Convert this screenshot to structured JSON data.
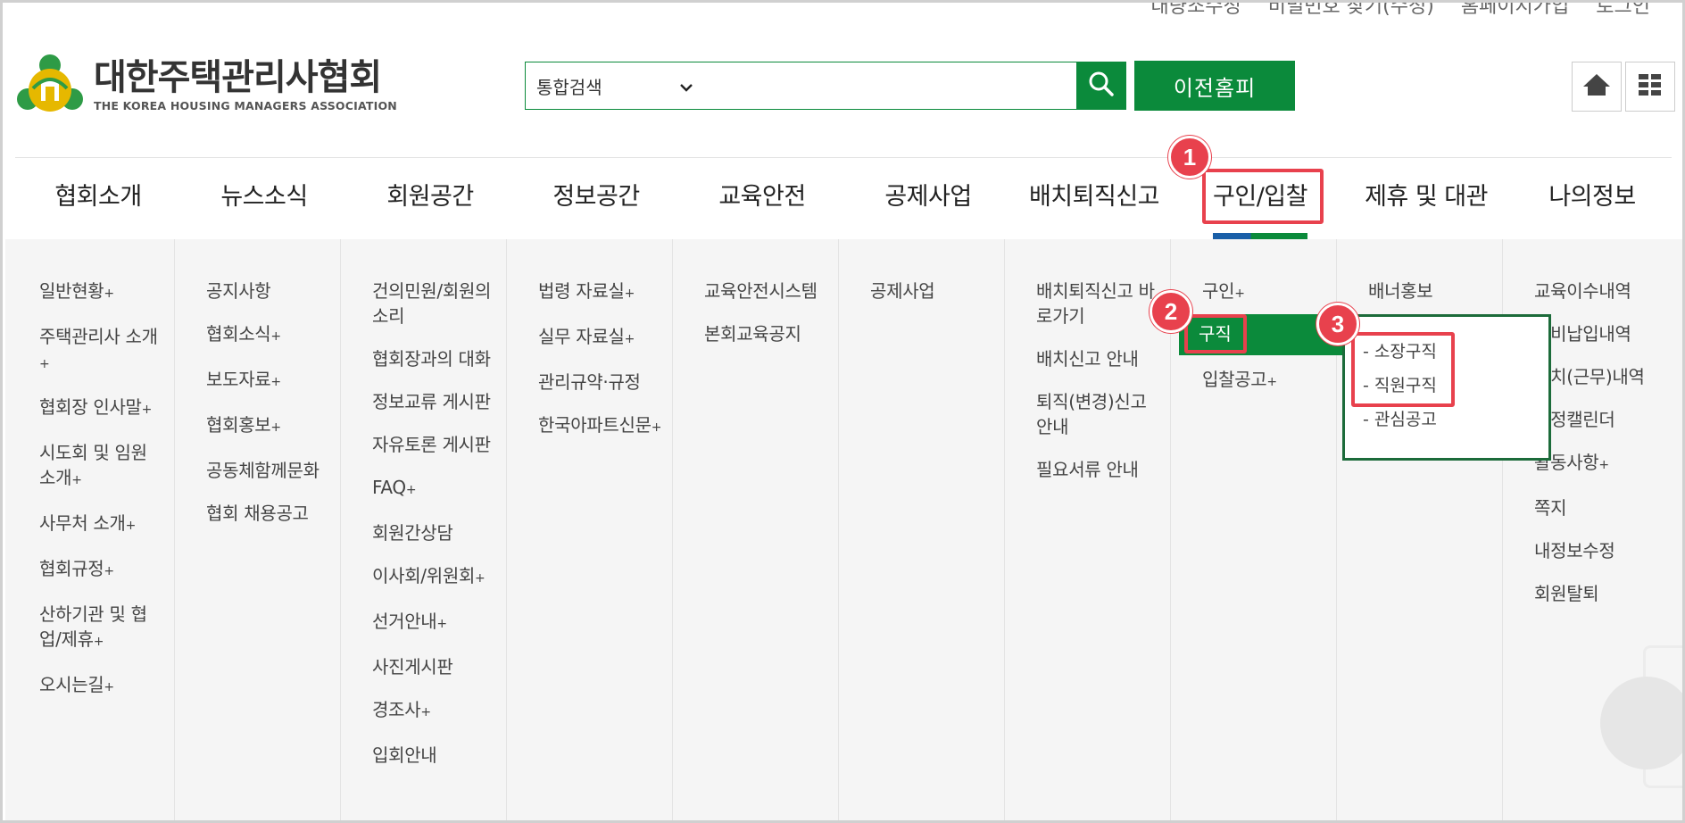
{
  "util_links": [
    "대량조수정",
    "비밀번호 찾기(수정)",
    "홈페이지가입",
    "로그인"
  ],
  "logo": {
    "name": "대한주택관리사협회",
    "sub": "THE KOREA HOUSING MANAGERS ASSOCIATION"
  },
  "search": {
    "select_label": "통합검색",
    "placeholder": ""
  },
  "prev_home_label": "이전홈피",
  "icons": {
    "search": "search-icon",
    "home": "home-icon",
    "menu": "grid-menu-icon"
  },
  "gnb": [
    "협회소개",
    "뉴스소식",
    "회원공간",
    "정보공간",
    "교육안전",
    "공제사업",
    "배치퇴직신고",
    "구인/입찰",
    "제휴 및 대관",
    "나의정보"
  ],
  "menu_columns": [
    [
      {
        "t": "일반현황",
        "p": "+"
      },
      {
        "t": "주택관리사 소개",
        "p": "+"
      },
      {
        "t": "협회장 인사말",
        "p": "+"
      },
      {
        "t": "시도회 및 임원 소개",
        "p": "+"
      },
      {
        "t": "사무처 소개",
        "p": "+"
      },
      {
        "t": "협회규정",
        "p": "+"
      },
      {
        "t": "산하기관 및 협업/제휴",
        "p": "+"
      },
      {
        "t": "오시는길",
        "p": "+"
      }
    ],
    [
      {
        "t": "공지사항",
        "p": ""
      },
      {
        "t": "협회소식",
        "p": "+"
      },
      {
        "t": "보도자료",
        "p": "+"
      },
      {
        "t": "협회홍보",
        "p": "+"
      },
      {
        "t": "공동체함께문화",
        "p": ""
      },
      {
        "t": "협회 채용공고",
        "p": ""
      }
    ],
    [
      {
        "t": "건의민원/회원의 소리",
        "p": ""
      },
      {
        "t": "협회장과의 대화",
        "p": ""
      },
      {
        "t": "정보교류 게시판",
        "p": ""
      },
      {
        "t": "자유토론 게시판",
        "p": ""
      },
      {
        "t": "FAQ",
        "p": "+"
      },
      {
        "t": "회원간상담",
        "p": ""
      },
      {
        "t": "이사회/위원회",
        "p": "+"
      },
      {
        "t": "선거안내",
        "p": "+"
      },
      {
        "t": "사진게시판",
        "p": ""
      },
      {
        "t": "경조사",
        "p": "+"
      },
      {
        "t": "입회안내",
        "p": ""
      }
    ],
    [
      {
        "t": "법령 자료실",
        "p": "+"
      },
      {
        "t": "실무 자료실",
        "p": "+"
      },
      {
        "t": "관리규약·규정",
        "p": ""
      },
      {
        "t": "한국아파트신문",
        "p": "+"
      }
    ],
    [
      {
        "t": "교육안전시스템",
        "p": ""
      },
      {
        "t": "본회교육공지",
        "p": ""
      }
    ],
    [
      {
        "t": "공제사업",
        "p": ""
      }
    ],
    [
      {
        "t": "배치퇴직신고 바로가기",
        "p": ""
      },
      {
        "t": "배치신고 안내",
        "p": ""
      },
      {
        "t": "퇴직(변경)신고 안내",
        "p": ""
      },
      {
        "t": "필요서류 안내",
        "p": ""
      }
    ],
    [
      {
        "t": "구인",
        "p": "+"
      },
      {
        "t": "",
        "p": ""
      },
      {
        "t": "입찰공고",
        "p": "+"
      }
    ],
    [
      {
        "t": "배너홍보",
        "p": ""
      }
    ],
    [
      {
        "t": "교육이수내역",
        "p": ""
      },
      {
        "t": "회비납입내역",
        "p": ""
      },
      {
        "t": "배치(근무)내역",
        "p": ""
      },
      {
        "t": "일정캘린더",
        "p": ""
      },
      {
        "t": "활동사항",
        "p": "+"
      },
      {
        "t": "쪽지",
        "p": ""
      },
      {
        "t": "내정보수정",
        "p": ""
      },
      {
        "t": "회원탈퇴",
        "p": ""
      }
    ]
  ],
  "selected_item": "구직",
  "submenu": [
    "- 소장구직",
    "- 직원구직",
    "- 관심공고"
  ],
  "badges": [
    "1",
    "2",
    "3"
  ],
  "colors": {
    "brand_green": "#0b8a3b",
    "annotation_red": "#e8414d",
    "submenu_border": "#1c6b3a"
  }
}
